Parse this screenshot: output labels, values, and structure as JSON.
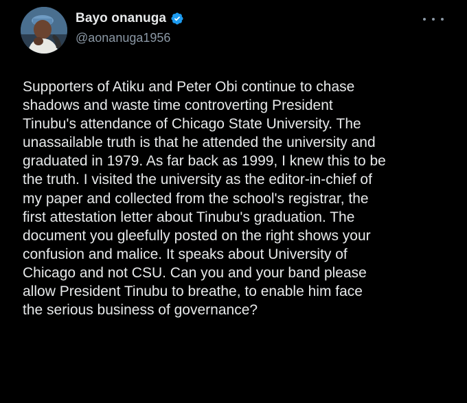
{
  "author": {
    "display_name": "Bayo onanuga",
    "handle": "@aonanuga1956",
    "verified_icon": "verified-badge-icon",
    "avatar_icon": "profile-photo"
  },
  "menu": {
    "more_icon": "more-options-icon"
  },
  "post": {
    "text": "Supporters of Atiku and Peter Obi continue to chase\nshadows and waste  time controverting  President\nTinubu's   attendance of Chicago State University. The\nunassailable truth is that he attended the university and\ngraduated in 1979. As far back as 1999, I knew this to be\nthe truth. I visited the university as the editor-in-chief of\nmy paper and collected from the school's registrar,  the\nfirst attestation letter about Tinubu's graduation.  The\ndocument you gleefully posted on the right shows your\nconfusion and malice. It speaks about University of\nChicago and not CSU. Can you  and your band please\nallow President Tinubu to breathe, to enable him face\nthe serious business of governance?"
  },
  "colors": {
    "background": "#000000",
    "text_primary": "#e7e9ea",
    "text_secondary": "#8b98a5",
    "verified_blue": "#1d9bf0"
  }
}
